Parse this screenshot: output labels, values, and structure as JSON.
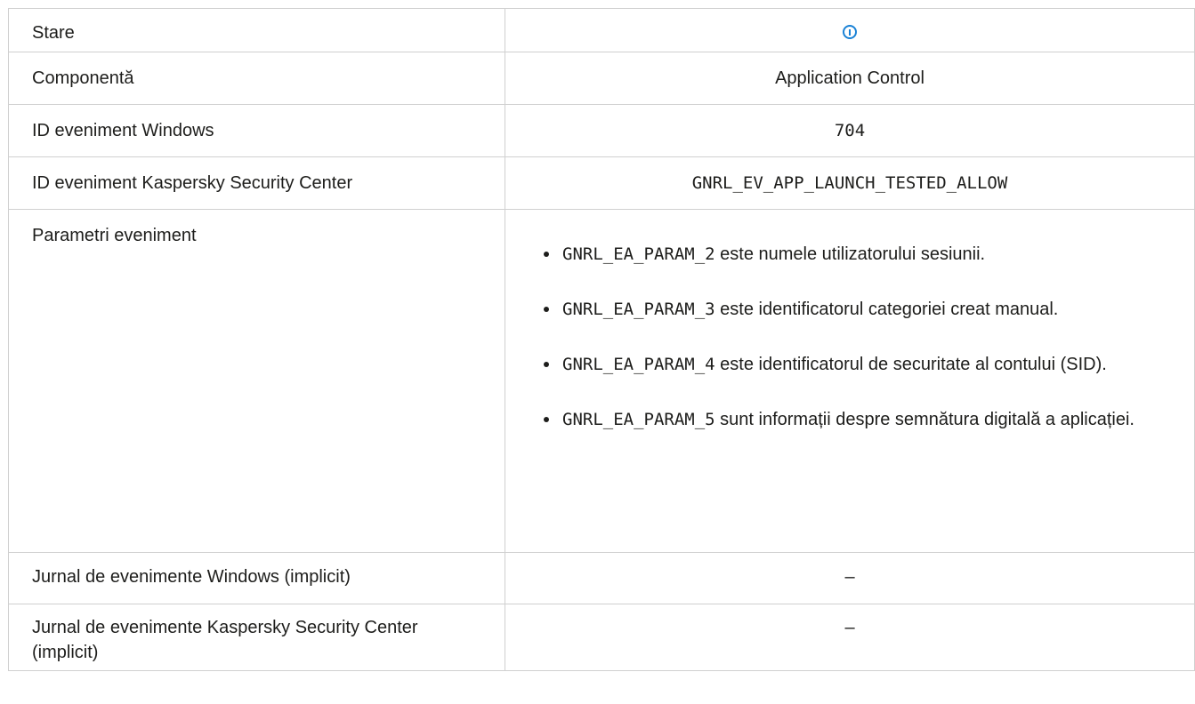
{
  "rows": {
    "status": {
      "label": "Stare",
      "icon": "info-icon",
      "icon_color": "#1a82d6"
    },
    "component": {
      "label": "Componentă",
      "value": "Application Control"
    },
    "windows_event_id": {
      "label": "ID eveniment Windows",
      "value": "704"
    },
    "ksc_event_id": {
      "label": "ID eveniment Kaspersky Security Center",
      "value": "GNRL_EV_APP_LAUNCH_TESTED_ALLOW"
    },
    "event_params": {
      "label": "Parametri eveniment",
      "items": [
        {
          "code": "GNRL_EA_PARAM_2",
          "text": "este numele utilizatorului sesiunii."
        },
        {
          "code": "GNRL_EA_PARAM_3",
          "text": "este identificatorul categoriei creat manual."
        },
        {
          "code": "GNRL_EA_PARAM_4",
          "text": "este identificatorul de securitate al contului (SID)."
        },
        {
          "code": "GNRL_EA_PARAM_5",
          "text": "sunt informații despre semnătura digitală a aplicației."
        }
      ]
    },
    "windows_log": {
      "label": "Jurnal de evenimente Windows (implicit)",
      "value": "–"
    },
    "ksc_log": {
      "label": "Jurnal de evenimente Kaspersky Security Center (implicit)",
      "value": "–"
    }
  }
}
